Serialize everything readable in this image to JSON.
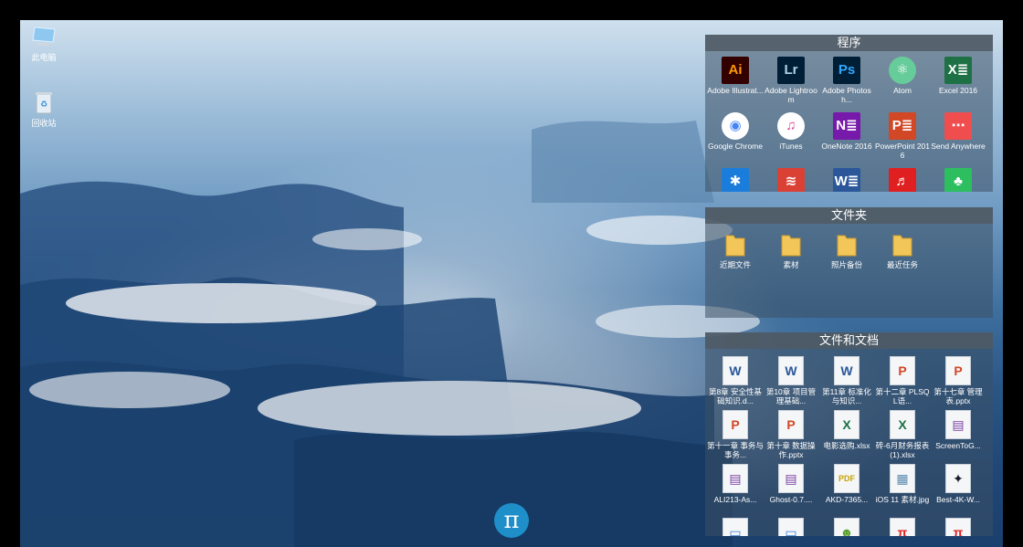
{
  "desktop_icons": [
    {
      "label": "此电脑",
      "icon": "computer-icon"
    },
    {
      "label": "回收站",
      "icon": "recycle-bin-icon"
    }
  ],
  "panels": {
    "programs": {
      "title": "程序",
      "items": [
        {
          "label": "Adobe Illustrat...",
          "icon": "adobe-illustrator-icon",
          "glyph": "Ai",
          "color": "#ff9a00",
          "bg": "#330000"
        },
        {
          "label": "Adobe Lightroom",
          "icon": "adobe-lightroom-icon",
          "glyph": "Lr",
          "color": "#add5ec",
          "bg": "#001e36"
        },
        {
          "label": "Adobe Photosh...",
          "icon": "adobe-photoshop-icon",
          "glyph": "Ps",
          "color": "#31a8ff",
          "bg": "#001e36"
        },
        {
          "label": "Atom",
          "icon": "atom-icon",
          "glyph": "⚛",
          "color": "#ffffff",
          "bg": "#66cc99"
        },
        {
          "label": "Excel 2016",
          "icon": "excel-icon",
          "glyph": "X≣",
          "color": "#ffffff",
          "bg": "#1e7145"
        },
        {
          "label": "Google Chrome",
          "icon": "chrome-icon",
          "glyph": "◉",
          "color": "#4285f4",
          "bg": "#ffffff"
        },
        {
          "label": "iTunes",
          "icon": "itunes-icon",
          "glyph": "♫",
          "color": "#e0409a",
          "bg": "#ffffff"
        },
        {
          "label": "OneNote 2016",
          "icon": "onenote-icon",
          "glyph": "N≣",
          "color": "#ffffff",
          "bg": "#7719aa"
        },
        {
          "label": "PowerPoint 2016",
          "icon": "powerpoint-icon",
          "glyph": "P≣",
          "color": "#ffffff",
          "bg": "#d24726"
        },
        {
          "label": "Send Anywhere",
          "icon": "send-anywhere-icon",
          "glyph": "⋯",
          "color": "#ffffff",
          "bg": "#f04e4e"
        },
        {
          "label": "",
          "icon": "star-app-icon",
          "glyph": "✱",
          "color": "#ffffff",
          "bg": "#1a7ddb"
        },
        {
          "label": "",
          "icon": "todoist-icon",
          "glyph": "≋",
          "color": "#ffffff",
          "bg": "#db4035"
        },
        {
          "label": "",
          "icon": "word-icon",
          "glyph": "W≣",
          "color": "#ffffff",
          "bg": "#2b579a"
        },
        {
          "label": "",
          "icon": "netease-music-icon",
          "glyph": "♬",
          "color": "#ffffff",
          "bg": "#e02020"
        },
        {
          "label": "",
          "icon": "evernote-icon",
          "glyph": "♣",
          "color": "#ffffff",
          "bg": "#2dbe60"
        }
      ]
    },
    "folders": {
      "title": "文件夹",
      "items": [
        {
          "label": "近期文件",
          "icon": "folder-icon"
        },
        {
          "label": "素材",
          "icon": "folder-icon"
        },
        {
          "label": "照片备份",
          "icon": "folder-icon"
        },
        {
          "label": "最近任务",
          "icon": "folder-icon"
        }
      ]
    },
    "files": {
      "title": "文件和文档",
      "items": [
        {
          "label": "第8章 安全性基础知识.d...",
          "icon": "word-doc-icon",
          "glyph": "W",
          "color": "#2b579a"
        },
        {
          "label": "第10章 项目管理基础...",
          "icon": "word-doc-icon",
          "glyph": "W",
          "color": "#2b579a"
        },
        {
          "label": "第11章 标准化与知识...",
          "icon": "word-doc-icon",
          "glyph": "W",
          "color": "#2b579a"
        },
        {
          "label": "第十二章 PLSQL语...",
          "icon": "pptx-icon",
          "glyph": "P",
          "color": "#d24726"
        },
        {
          "label": "第十七章 管理表.pptx",
          "icon": "pptx-icon",
          "glyph": "P",
          "color": "#d24726"
        },
        {
          "label": "第十一章 事务与事务...",
          "icon": "pptx-icon",
          "glyph": "P",
          "color": "#d24726"
        },
        {
          "label": "第十章 数据操作.pptx",
          "icon": "pptx-icon",
          "glyph": "P",
          "color": "#d24726"
        },
        {
          "label": "电影选购.xlsx",
          "icon": "xlsx-icon",
          "glyph": "X",
          "color": "#1e7145"
        },
        {
          "label": "砖-6月财务报表 (1).xlsx",
          "icon": "xlsx-icon",
          "glyph": "X",
          "color": "#1e7145"
        },
        {
          "label": "ScreenToG...",
          "icon": "rar-archive-icon",
          "glyph": "▤",
          "color": "#7b3fa0"
        },
        {
          "label": "ALI213-As...",
          "icon": "rar-archive-icon",
          "glyph": "▤",
          "color": "#7b3fa0"
        },
        {
          "label": "Ghost-0.7....",
          "icon": "rar-archive-icon",
          "glyph": "▤",
          "color": "#7b3fa0"
        },
        {
          "label": "AKD-7365...",
          "icon": "pdf-icon",
          "glyph": "PDF",
          "color": "#c8a200"
        },
        {
          "label": "iOS 11 素材.jpg",
          "icon": "image-jpg-icon",
          "glyph": "▦",
          "color": "#5a8ab0"
        },
        {
          "label": "Best-4K-W...",
          "icon": "image-thumb-icon",
          "glyph": "✦",
          "color": "#1a1a2e"
        },
        {
          "label": "",
          "icon": "window-file-icon",
          "glyph": "▭",
          "color": "#3a7bd5"
        },
        {
          "label": "",
          "icon": "window-file-icon",
          "glyph": "▭",
          "color": "#3a7bd5"
        },
        {
          "label": "",
          "icon": "frog-file-icon",
          "glyph": "☻",
          "color": "#5aa02c"
        },
        {
          "label": "",
          "icon": "pi-file-icon",
          "glyph": "π",
          "color": "#e02020"
        },
        {
          "label": "",
          "icon": "pi-file-icon",
          "glyph": "π",
          "color": "#e02020"
        }
      ]
    }
  },
  "launcher": {
    "glyph": "π",
    "icon": "pi-launcher-icon"
  }
}
